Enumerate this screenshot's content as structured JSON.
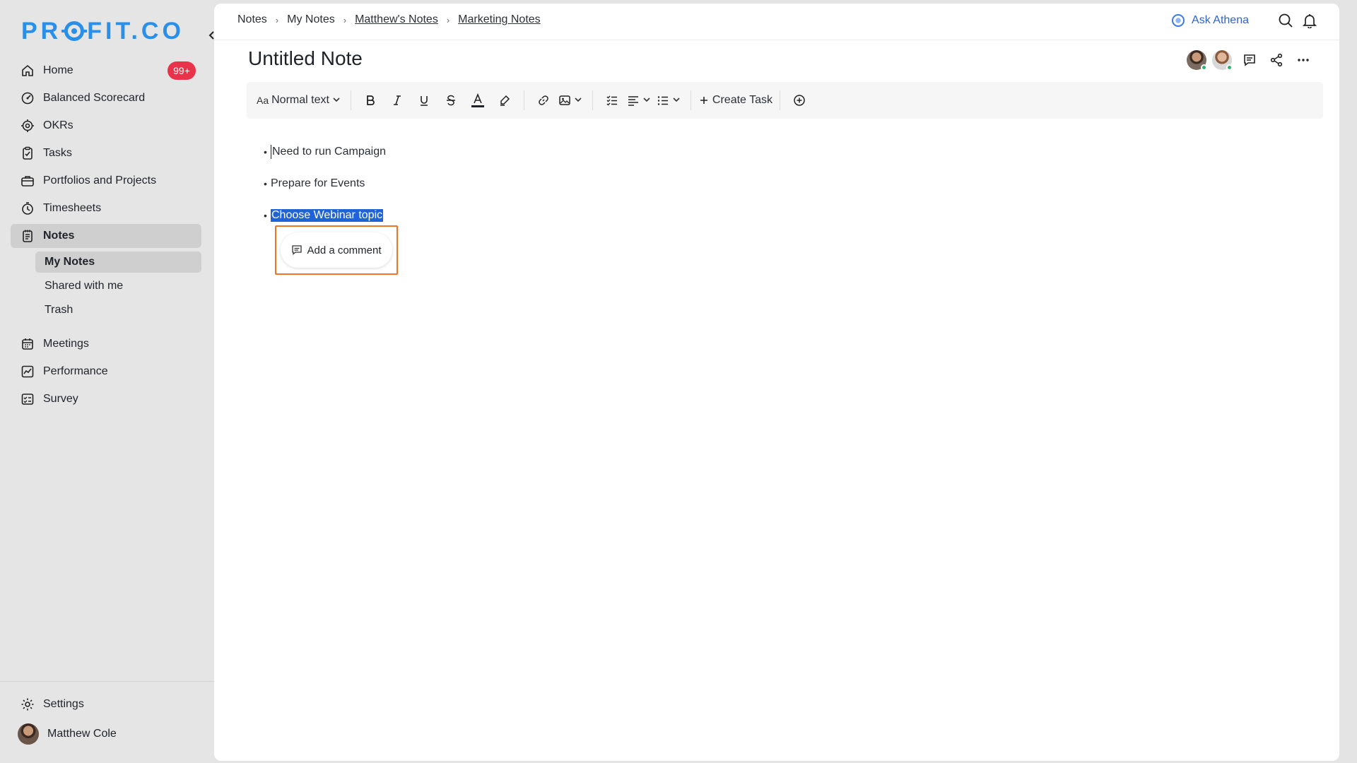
{
  "brand": {
    "logo_text_left": "PR",
    "logo_text_right": "FIT.CO",
    "color": "#2a8fe8"
  },
  "sidebar": {
    "items": [
      {
        "label": "Home",
        "icon": "home-icon",
        "badge": "99+"
      },
      {
        "label": "Balanced Scorecard",
        "icon": "scorecard-icon"
      },
      {
        "label": "OKRs",
        "icon": "target-icon"
      },
      {
        "label": "Tasks",
        "icon": "clipboard-icon"
      },
      {
        "label": "Portfolios and Projects",
        "icon": "briefcase-icon"
      },
      {
        "label": "Timesheets",
        "icon": "stopwatch-icon"
      },
      {
        "label": "Notes",
        "icon": "notes-icon"
      }
    ],
    "sub_items": [
      {
        "label": "My Notes"
      },
      {
        "label": "Shared with me"
      },
      {
        "label": "Trash"
      }
    ],
    "items2": [
      {
        "label": "Meetings",
        "icon": "calendar-icon"
      },
      {
        "label": "Performance",
        "icon": "chart-icon"
      },
      {
        "label": "Survey",
        "icon": "survey-icon"
      }
    ],
    "settings_label": "Settings",
    "user_name": "Matthew Cole"
  },
  "breadcrumb": [
    "Notes",
    "My Notes",
    "Matthew's Notes",
    "Marketing Notes"
  ],
  "top": {
    "athena_label": "Ask Athena"
  },
  "note": {
    "title": "Untitled Note",
    "bullets": [
      "Need to run Campaign",
      "Prepare for Events",
      "Choose Webinar topic"
    ]
  },
  "toolbar": {
    "text_style": "Normal text",
    "text_style_prefix": "Aa",
    "create_task": "Create Task"
  },
  "comment": {
    "label": "Add a comment",
    "highlight_color": "#f07427"
  },
  "colors": {
    "selection": "#1f63d6",
    "badge": "#e8334a",
    "online": "#2fb36b"
  }
}
